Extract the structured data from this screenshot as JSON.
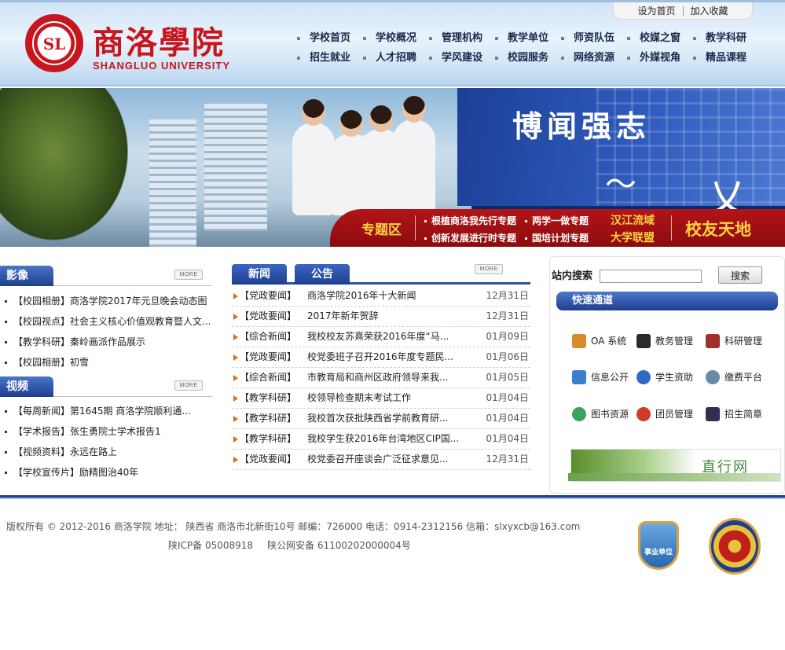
{
  "top_links": {
    "set_home": "设为首页",
    "add_favorite": "加入收藏"
  },
  "branding": {
    "logo_text": "SL",
    "name_cn": "商洛學院",
    "name_en": "SHANGLUO UNIVERSITY"
  },
  "nav": {
    "row1": [
      "学校首页",
      "学校概况",
      "管理机构",
      "教学单位",
      "师资队伍",
      "校媒之窗",
      "教学科研"
    ],
    "row2": [
      "招生就业",
      "人才招聘",
      "学风建设",
      "校园服务",
      "网络资源",
      "外媒视角",
      "精品课程"
    ]
  },
  "banner": {
    "slogan": "博闻强志",
    "special_title": "专题区",
    "special_links": {
      "a": "根植商洛我先行专题",
      "b": "两学一做专题",
      "c": "创新发展进行时专题",
      "d": "国培计划专题"
    },
    "gold_links": {
      "a": "汉江流域",
      "b": "大学联盟"
    },
    "alumni": "校友天地"
  },
  "more_label": "MORE",
  "images": {
    "title": "影像",
    "items": [
      "【校园相册】商洛学院2017年元旦晚会动态图",
      "【校园视点】社会主义核心价值观教育暨人文...",
      "【教学科研】秦岭画派作品展示",
      "【校园相册】初雪"
    ]
  },
  "videos": {
    "title": "视频",
    "items": [
      "【每周新闻】第1645期 商洛学院顺利通...",
      "【学术报告】张生勇院士学术报告1",
      "【视频资料】永远在路上",
      "【学校宣传片】励精图治40年"
    ]
  },
  "news": {
    "tab_news": "新闻",
    "tab_notice": "公告",
    "rows": [
      {
        "cat": "【党政要闻】",
        "title": "商洛学院2016年十大新闻",
        "date": "12月31日"
      },
      {
        "cat": "【党政要闻】",
        "title": "2017年新年贺辞",
        "date": "12月31日"
      },
      {
        "cat": "【综合新闻】",
        "title": "我校校友苏熹荣获2016年度“马...",
        "date": "01月09日"
      },
      {
        "cat": "【党政要闻】",
        "title": "校党委班子召开2016年度专题民...",
        "date": "01月06日"
      },
      {
        "cat": "【综合新闻】",
        "title": "市教育局和商州区政府领导来我...",
        "date": "01月05日"
      },
      {
        "cat": "【教学科研】",
        "title": "校领导检查期末考试工作",
        "date": "01月04日"
      },
      {
        "cat": "【教学科研】",
        "title": "我校首次获批陕西省学前教育研...",
        "date": "01月04日"
      },
      {
        "cat": "【教学科研】",
        "title": "我校学生获2016年台湾地区CIP国...",
        "date": "01月04日"
      },
      {
        "cat": "【党政要闻】",
        "title": "校党委召开座谈会广泛征求意见...",
        "date": "12月31日"
      }
    ]
  },
  "search": {
    "label": "站内搜索",
    "placeholder": "",
    "button": "搜索"
  },
  "quick": {
    "title": "快速通道",
    "items": [
      {
        "label": "OA 系统",
        "icon": "oa-system-icon",
        "color": "#d98b2b"
      },
      {
        "label": "教务管理",
        "icon": "academic-affairs-icon",
        "color": "#2a2a2a"
      },
      {
        "label": "科研管理",
        "icon": "research-books-icon",
        "color": "#a0302a"
      },
      {
        "label": "信息公开",
        "icon": "info-open-icon",
        "color": "#3c7fcf"
      },
      {
        "label": "学生资助",
        "icon": "student-aid-icon",
        "color": "#2f6ac2"
      },
      {
        "label": "缴费平台",
        "icon": "payment-icon",
        "color": "#6a8aa8"
      },
      {
        "label": "图书资源",
        "icon": "library-chat-icon",
        "color": "#3ea35a"
      },
      {
        "label": "团员管理",
        "icon": "league-badge-icon",
        "color": "#d23a2a"
      },
      {
        "label": "招生简章",
        "icon": "graduate-cap-icon",
        "color": "#2f2f4f"
      }
    ]
  },
  "zhixing_banner": "直行网",
  "footer": {
    "copyright": "版权所有 © 2012-2016 商洛学院 地址： 陕西省 商洛市北新街10号 邮编：726000 电话：0914-2312156 信箱：slxyxcb@163.com",
    "icp": "陕ICP备 05008918",
    "police_record": "陕公网安备 61100202000004号",
    "public_badge_label": "事业单位"
  },
  "colors": {
    "brand_red": "#c7161d",
    "nav_blue": "#1e3f8e",
    "gold": "#ffd23f",
    "accent_orange": "#e36a10"
  }
}
